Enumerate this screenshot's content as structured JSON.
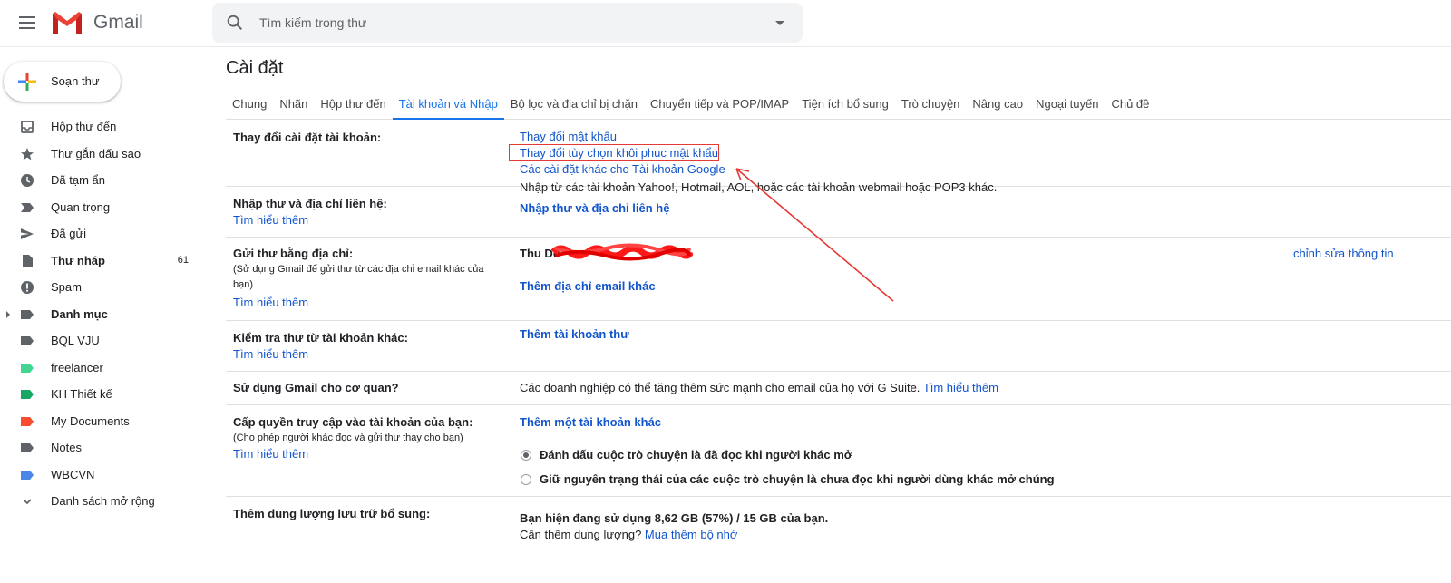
{
  "header": {
    "app_name": "Gmail",
    "search_placeholder": "Tìm kiếm trong thư"
  },
  "compose_label": "Soạn thư",
  "nav": [
    {
      "label": "Hộp thư đến",
      "icon": "inbox-icon",
      "bold": false,
      "count": ""
    },
    {
      "label": "Thư gắn dấu sao",
      "icon": "star-icon",
      "bold": false,
      "count": ""
    },
    {
      "label": "Đã tạm ẩn",
      "icon": "clock-icon",
      "bold": false,
      "count": ""
    },
    {
      "label": "Quan trọng",
      "icon": "important-icon",
      "bold": false,
      "count": ""
    },
    {
      "label": "Đã gửi",
      "icon": "send-icon",
      "bold": false,
      "count": ""
    },
    {
      "label": "Thư nháp",
      "icon": "draft-icon",
      "bold": true,
      "count": "61"
    },
    {
      "label": "Spam",
      "icon": "spam-icon",
      "bold": false,
      "count": ""
    },
    {
      "label": "Danh mục",
      "icon": "label-icon",
      "bold": true,
      "count": "",
      "expandable": true
    },
    {
      "label": "BQL VJU",
      "icon": "label-icon",
      "bold": false,
      "count": "",
      "color": "#5f6368"
    },
    {
      "label": "freelancer",
      "icon": "label-icon",
      "bold": false,
      "count": "",
      "color": "#43d692"
    },
    {
      "label": "KH Thiết kế",
      "icon": "label-icon",
      "bold": false,
      "count": "",
      "color": "#16a765"
    },
    {
      "label": "My Documents",
      "icon": "label-icon",
      "bold": false,
      "count": "",
      "color": "#fb4c2f"
    },
    {
      "label": "Notes",
      "icon": "label-icon",
      "bold": false,
      "count": "",
      "color": "#5f6368"
    },
    {
      "label": "WBCVN",
      "icon": "label-icon",
      "bold": false,
      "count": "",
      "color": "#4a86e8"
    },
    {
      "label": "Danh sách mở rộng",
      "icon": "chevron-down-icon",
      "bold": false,
      "count": ""
    }
  ],
  "page_title": "Cài đặt",
  "tabs": [
    {
      "label": "Chung",
      "active": false
    },
    {
      "label": "Nhãn",
      "active": false
    },
    {
      "label": "Hộp thư đến",
      "active": false
    },
    {
      "label": "Tài khoản và Nhập",
      "active": true
    },
    {
      "label": "Bộ lọc và địa chỉ bị chặn",
      "active": false
    },
    {
      "label": "Chuyển tiếp và POP/IMAP",
      "active": false
    },
    {
      "label": "Tiện ích bổ sung",
      "active": false
    },
    {
      "label": "Trò chuyện",
      "active": false
    },
    {
      "label": "Nâng cao",
      "active": false
    },
    {
      "label": "Ngoại tuyến",
      "active": false
    },
    {
      "label": "Chủ đề",
      "active": false
    }
  ],
  "sections": {
    "account": {
      "label": "Thay đổi cài đặt tài khoản:",
      "links": [
        "Thay đổi mật khẩu",
        "Thay đổi tùy chọn khôi phục mật khẩu",
        "Các cài đặt khác cho Tài khoản Google"
      ]
    },
    "import": {
      "label": "Nhập thư và địa chỉ liên hệ:",
      "learn_more": "Tìm hiểu thêm",
      "desc": "Nhập từ các tài khoản Yahoo!, Hotmail, AOL, hoặc các tài khoản webmail hoặc POP3 khác.",
      "action": "Nhập thư và địa chỉ liên hệ"
    },
    "send_as": {
      "label": "Gửi thư bằng địa chỉ:",
      "sub": "(Sử dụng Gmail để gửi thư từ các địa chỉ email khác của bạn)",
      "learn_more": "Tìm hiểu thêm",
      "name": "Thu Do",
      "edit": "chỉnh sửa thông tin",
      "action": "Thêm địa chỉ email khác"
    },
    "check_mail": {
      "label": "Kiểm tra thư từ tài khoản khác:",
      "learn_more": "Tìm hiểu thêm",
      "action": "Thêm tài khoản thư"
    },
    "gsuite": {
      "label": "Sử dụng Gmail cho cơ quan?",
      "desc": "Các doanh nghiệp có thể tăng thêm sức mạnh cho email của họ với G Suite.",
      "learn_more": "Tìm hiểu thêm"
    },
    "grant": {
      "label": "Cấp quyền truy cập vào tài khoản của bạn:",
      "sub": "(Cho phép người khác đọc và gửi thư thay cho bạn)",
      "learn_more": "Tìm hiểu thêm",
      "action": "Thêm một tài khoản khác",
      "option1": "Đánh dấu cuộc trò chuyện là đã đọc khi người khác mở",
      "option2": "Giữ nguyên trạng thái của các cuộc trò chuyện là chưa đọc khi người dùng khác mở chúng"
    },
    "storage": {
      "label": "Thêm dung lượng lưu trữ bổ sung:",
      "usage": "Bạn hiện đang sử dụng 8,62 GB (57%) / 15 GB của bạn.",
      "need_more": "Cần thêm dung lượng?",
      "buy": "Mua thêm bộ nhớ"
    }
  },
  "colors": {
    "accent": "#1a73e8",
    "link": "#1155cc",
    "annotation": "#e53935"
  }
}
